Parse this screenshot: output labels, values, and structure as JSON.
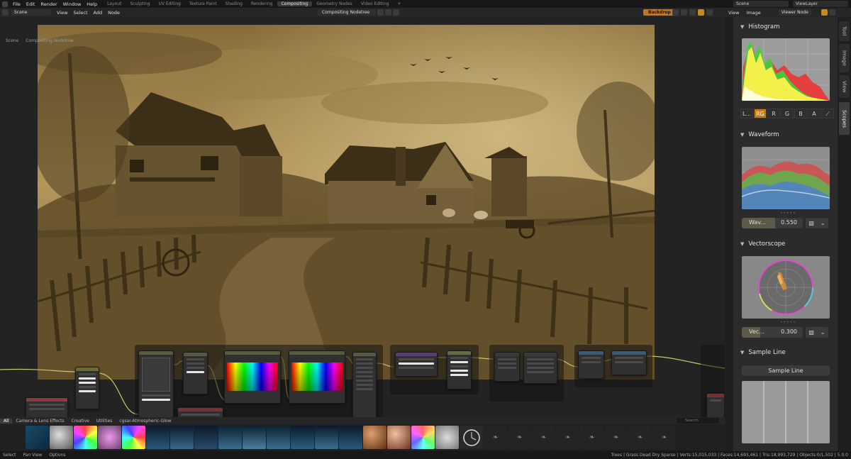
{
  "topbar": {
    "menus": [
      "File",
      "Edit",
      "Render",
      "Window",
      "Help"
    ],
    "workspaces": [
      "Layout",
      "Sculpting",
      "UV Editing",
      "Texture Paint",
      "Shading",
      "Rendering",
      "Compositing",
      "Geometry Nodes",
      "Video Editing"
    ],
    "active_workspace": "Compositing",
    "add_tab": "+",
    "scene": "Scene",
    "view_layer": "ViewLayer"
  },
  "editor_header": {
    "scene_field": "Scene",
    "menus": [
      "View",
      "Select",
      "Add",
      "Node"
    ],
    "node_tree": "Compositing Nodetree",
    "backdrop_label": "Backdrop"
  },
  "image_header": {
    "menus": [
      "View",
      "Image"
    ],
    "viewer_node": "Viewer Node"
  },
  "breadcrumb": {
    "scene": "Scene",
    "tree": "Compositing Nodetree"
  },
  "asset_shelf": {
    "tabs": [
      "All",
      "Camera & Lens Effects",
      "Creative",
      "Utilities",
      "cgsar-Atmospheric-Glow"
    ],
    "active_tab": "All",
    "search_placeholder": "Search"
  },
  "status_bar": {
    "left": [
      "Select",
      "Pan View",
      "Options"
    ],
    "right": "Trees | Grass Dead Dry Sparse | Verts:15,015,033 | Faces:14,693,461 | Tris:18,993,729 | Objects:0/1,502 | 5.0.0"
  },
  "sidebar_tabs": [
    "Tool",
    "Image",
    "View",
    "Scopes"
  ],
  "active_sidebar_tab": "Scopes",
  "scopes": {
    "histogram": {
      "title": "Histogram",
      "channels": [
        "L...",
        "RG",
        "R",
        "G",
        "B",
        "A"
      ],
      "selected_channel": "RG"
    },
    "waveform": {
      "title": "Waveform",
      "label": "Wav...",
      "opacity": "0.550"
    },
    "vectorscope": {
      "title": "Vectorscope",
      "label": "Vec...",
      "opacity": "0.300"
    },
    "sample_line": {
      "title": "Sample Line",
      "button_label": "Sample Line"
    }
  },
  "colors": {
    "accent": "#c57c16",
    "backdrop_button": "#c9731a",
    "panel_bg": "#2b2b2b"
  }
}
